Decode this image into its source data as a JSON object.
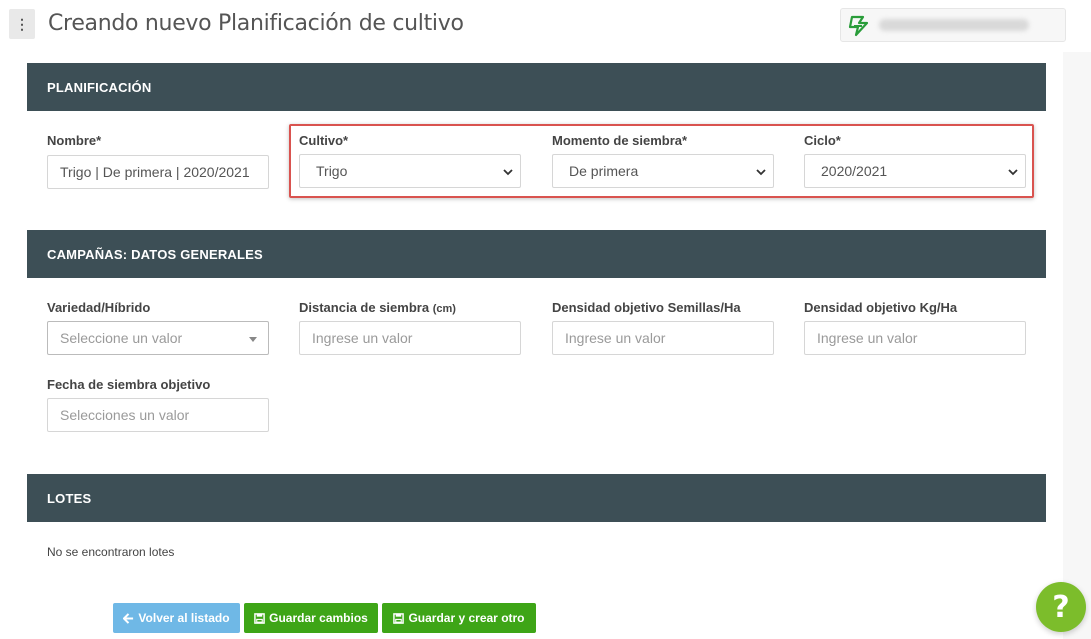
{
  "header": {
    "title": "Creando nuevo Planificación de cultivo",
    "menu_icon": "more-vertical-icon",
    "menu_glyph": "⋮",
    "brand_icon": "brand-logo-icon",
    "user_name": "",
    "brand_color": "#2a9d3a"
  },
  "planificacion": {
    "title": "PLANIFICACIÓN",
    "nombre_label": "Nombre*",
    "nombre_value": "Trigo | De primera | 2020/2021",
    "cultivo_label": "Cultivo*",
    "cultivo_value": "Trigo",
    "momento_label": "Momento de siembra*",
    "momento_value": "De primera",
    "ciclo_label": "Ciclo*",
    "ciclo_value": "2020/2021"
  },
  "campanas": {
    "title": "CAMPAÑAS: DATOS GENERALES",
    "variedad_label": "Variedad/Híbrido",
    "variedad_placeholder": "Seleccione un valor",
    "distancia_label": "Distancia de siembra",
    "distancia_unit": "(cm)",
    "distancia_placeholder": "Ingrese un valor",
    "densidad_semillas_label": "Densidad objetivo Semillas/Ha",
    "densidad_semillas_placeholder": "Ingrese un valor",
    "densidad_kg_label": "Densidad objetivo Kg/Ha",
    "densidad_kg_placeholder": "Ingrese un valor",
    "fecha_label": "Fecha de siembra objetivo",
    "fecha_placeholder": "Selecciones un valor"
  },
  "lotes": {
    "title": "LOTES",
    "empty_text": "No se encontraron lotes"
  },
  "buttons": {
    "back_label": "Volver al listado",
    "save_label": "Guardar cambios",
    "save_new_label": "Guardar y crear otro"
  },
  "help": {
    "glyph": "?",
    "icon": "help-icon"
  },
  "colors": {
    "section_header": "#3d4f56",
    "highlight": "#d9534f",
    "primary_green": "#3ea517",
    "info_blue": "#6fb8e6",
    "help_green": "#7cbd2b"
  }
}
